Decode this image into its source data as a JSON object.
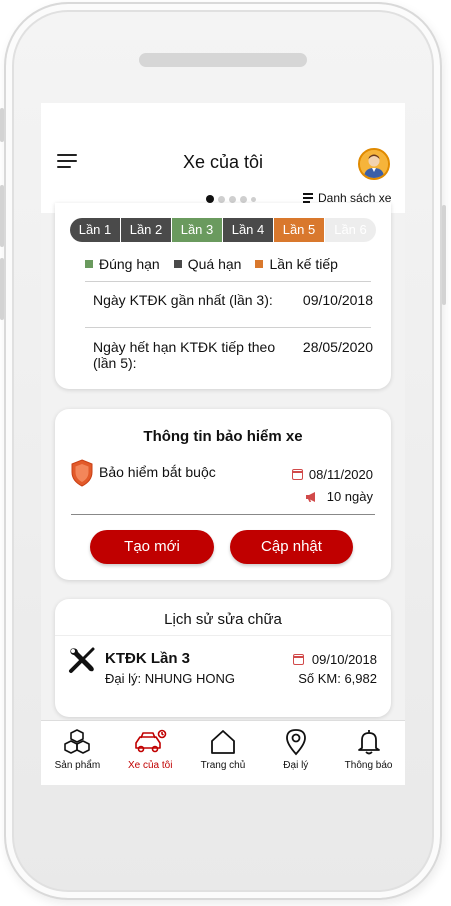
{
  "header": {
    "title": "Xe của tôi",
    "list_link": "Danh sách xe",
    "carousel_pages": 5,
    "carousel_active": 1
  },
  "inspection": {
    "rounds": [
      {
        "label": "Lần 1",
        "status": "overdue"
      },
      {
        "label": "Lần 2",
        "status": "overdue"
      },
      {
        "label": "Lần 3",
        "status": "on_time"
      },
      {
        "label": "Lần 4",
        "status": "overdue"
      },
      {
        "label": "Lần 5",
        "status": "next"
      },
      {
        "label": "Lần 6",
        "status": "future"
      }
    ],
    "legend": [
      {
        "label": "Đúng hạn",
        "color": "#6a9a5e"
      },
      {
        "label": "Quá hạn",
        "color": "#4a4a4a"
      },
      {
        "label": "Lần kế tiếp",
        "color": "#d9782d"
      }
    ],
    "last_label": "Ngày KTĐK gần nhất (lần 3):",
    "last_value": "09/10/2018",
    "next_label_line1": "Ngày hết hạn KTĐK tiếp theo",
    "next_label_line2": "(lần 5):",
    "next_value": "28/05/2020"
  },
  "insurance": {
    "title": "Thông tin bảo hiểm xe",
    "name": "Bảo hiểm bắt buộc",
    "date": "08/11/2020",
    "days": "10 ngày",
    "btn_new": "Tạo mới",
    "btn_update": "Cập nhật"
  },
  "repair": {
    "title": "Lịch sử sửa chữa",
    "item_title": "KTĐK Lần 3",
    "agent": "Đại lý: NHUNG HONG",
    "date": "09/10/2018",
    "km": "Số KM: 6,982"
  },
  "nav": [
    {
      "label": "Sản phẩm",
      "icon": "cubes-icon"
    },
    {
      "label": "Xe của tôi",
      "icon": "car-icon"
    },
    {
      "label": "Trang chủ",
      "icon": "home-icon"
    },
    {
      "label": "Đại lý",
      "icon": "location-pin-icon"
    },
    {
      "label": "Thông báo",
      "icon": "bell-icon"
    }
  ],
  "colors": {
    "accent": "#c00000",
    "overdue": "#4a4a4a",
    "on_time": "#6a9a5e",
    "next": "#d9782d",
    "future": "#ededed"
  }
}
